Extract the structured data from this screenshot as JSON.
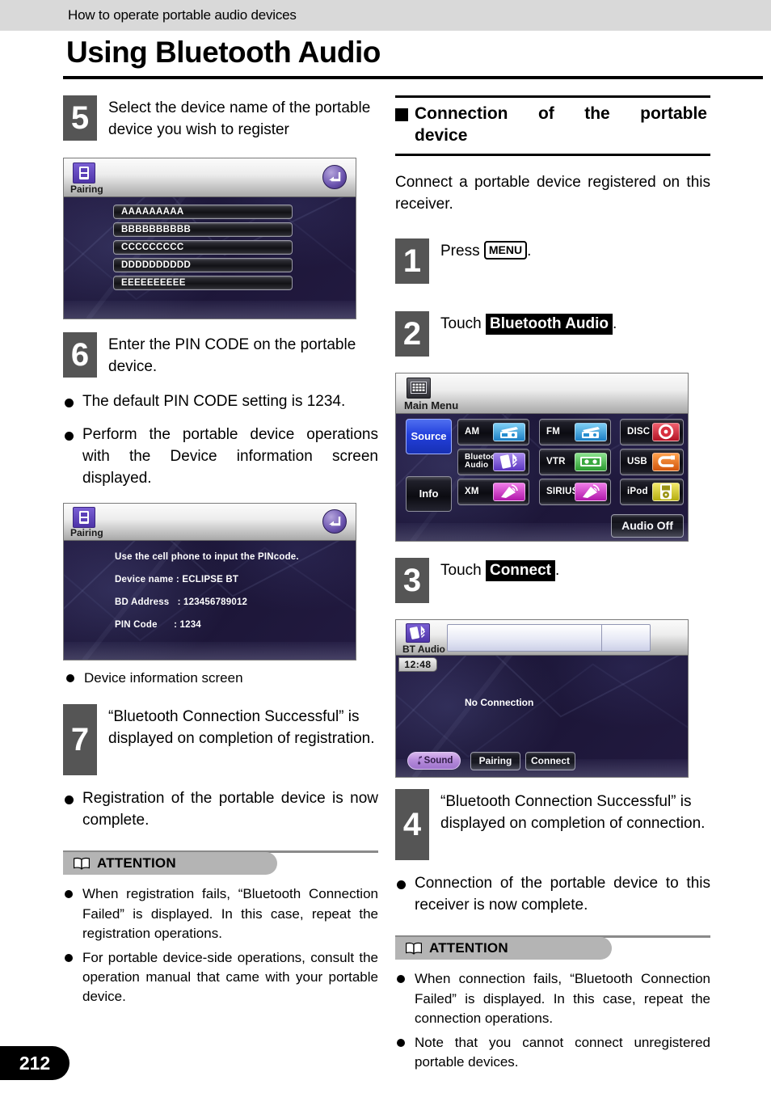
{
  "header": {
    "running_head": "How to operate portable audio devices",
    "title": "Using Bluetooth Audio"
  },
  "footer": {
    "page_number": "212"
  },
  "left_column": {
    "step5": {
      "number": "5",
      "text": "Select the device name of the portable device you wish to register"
    },
    "pairing_list_screen": {
      "title": "Pairing",
      "icon": "device-icon",
      "back_icon": "back-arrow-icon",
      "devices": [
        "AAAAAAAAA",
        "BBBBBBBBBB",
        "CCCCCCCCC",
        "DDDDDDDDDD",
        "EEEEEEEEEE"
      ]
    },
    "step6": {
      "number": "6",
      "text": "Enter the PIN CODE on the portable device."
    },
    "bullets_after_step6": [
      "The default PIN CODE setting is 1234.",
      "Perform the portable device operations with the Device information screen displayed."
    ],
    "device_info_screen": {
      "title": "Pairing",
      "icon": "device-icon",
      "back_icon": "back-arrow-icon",
      "lines": [
        "Use the cell phone to input the PINcode.",
        "Device name : ECLIPSE BT",
        "BD Address   : 123456789012",
        "PIN Code      : 1234"
      ]
    },
    "device_info_caption": "Device information screen",
    "step7": {
      "number": "7",
      "text": "“Bluetooth Connection Successful” is displayed on completion of registration."
    },
    "bullets_after_step7": [
      "Registration of the portable device is now complete."
    ],
    "attention": {
      "label": "ATTENTION",
      "icon": "open-book-icon",
      "items": [
        "When registration fails, “Bluetooth Connection Failed” is displayed.  In this case, repeat the registration operations.",
        "For portable device-side operations, consult the operation manual that came with your portable device."
      ]
    }
  },
  "right_column": {
    "section_heading": {
      "line1_words": [
        "Connection",
        "of",
        "the",
        "portable"
      ],
      "line2": "device"
    },
    "intro": "Connect a portable device registered on this receiver.",
    "step1": {
      "number": "1",
      "prefix": "Press ",
      "key": "MENU",
      "suffix": "."
    },
    "step2": {
      "number": "2",
      "prefix": "Touch ",
      "highlight": "Bluetooth Audio",
      "suffix": "."
    },
    "main_menu_screen": {
      "title": "Main Menu",
      "icon": "menu-grid-icon",
      "side_buttons": [
        {
          "label": "Source",
          "state": "active"
        },
        {
          "label": "Info",
          "state": "inactive"
        }
      ],
      "tiles": [
        {
          "label": "AM",
          "icon": "radio-icon",
          "color": "#3ea6e8"
        },
        {
          "label": "FM",
          "icon": "radio-icon",
          "color": "#3ea6e8"
        },
        {
          "label": "DISC",
          "icon": "disc-icon",
          "color": "#d8303f"
        },
        {
          "label": "Bluetooth Audio",
          "icon": "bluetooth-audio-icon",
          "color": "#7b4fd0"
        },
        {
          "label": "VTR",
          "icon": "cassette-icon",
          "color": "#46b84a"
        },
        {
          "label": "USB",
          "icon": "usb-icon",
          "color": "#e8751a"
        },
        {
          "label": "XM",
          "icon": "satellite-icon",
          "color": "#d63fd0"
        },
        {
          "label": "SIRIUS",
          "icon": "satellite-icon",
          "color": "#d63fd0"
        },
        {
          "label": "iPod",
          "icon": "ipod-icon",
          "color": "#d8d02a"
        }
      ],
      "audio_off_label": "Audio Off"
    },
    "step3": {
      "number": "3",
      "prefix": "Touch ",
      "highlight": "Connect",
      "suffix": "."
    },
    "bt_audio_screen": {
      "title": "BT Audio",
      "icon": "bluetooth-audio-icon",
      "clock": "12:48",
      "status": "No Connection",
      "buttons": [
        {
          "label": "Sound",
          "icon": "music-note-icon",
          "style": "pill"
        },
        {
          "label": "Pairing",
          "style": "dark"
        },
        {
          "label": "Connect",
          "style": "dark"
        }
      ]
    },
    "step4": {
      "number": "4",
      "text": "“Bluetooth Connection Successful” is displayed on completion of connection."
    },
    "bullets_after_step4": [
      "Connection of the portable device to this receiver is now complete."
    ],
    "attention": {
      "label": "ATTENTION",
      "icon": "open-book-icon",
      "items": [
        "When connection fails, “Bluetooth Connection Failed” is displayed.  In this case, repeat the connection operations.",
        "Note that you cannot connect unregistered portable devices."
      ]
    }
  }
}
